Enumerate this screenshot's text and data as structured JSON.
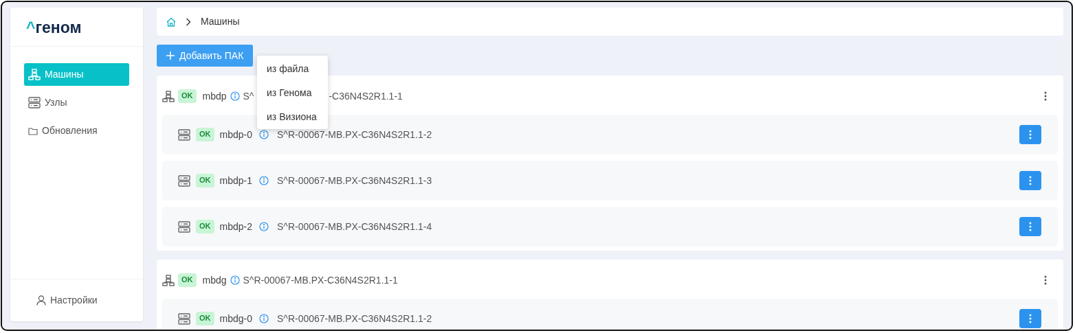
{
  "logo": {
    "mark": "^",
    "text": "геном"
  },
  "sidebar": {
    "items": [
      {
        "label": "Машины",
        "kind": "machines",
        "selected": true
      },
      {
        "label": "Узлы",
        "kind": "server",
        "selected": false
      },
      {
        "label": "Обновления",
        "kind": "folder",
        "selected": false
      }
    ],
    "footer": {
      "label": "Настройки"
    }
  },
  "breadcrumb": {
    "items": [
      "Машины"
    ]
  },
  "add_button": {
    "label": "Добавить ПАК"
  },
  "add_menu": {
    "items": [
      "из файла",
      "из Генома",
      "из Визиона"
    ]
  },
  "machines": [
    {
      "status": "OK",
      "name": "mbdp",
      "code": [
        "S^",
        "-C36N4S2R1.1-1"
      ],
      "nodes": [
        {
          "status": "OK",
          "name": "mbdp-0",
          "code": "S^R-00067-MB.PX-C36N4S2R1.1-2"
        },
        {
          "status": "OK",
          "name": "mbdp-1",
          "code": "S^R-00067-MB.PX-C36N4S2R1.1-3"
        },
        {
          "status": "OK",
          "name": "mbdp-2",
          "code": "S^R-00067-MB.PX-C36N4S2R1.1-4"
        }
      ]
    },
    {
      "status": "OK",
      "name": "mbdg",
      "code": [
        "S^R-00067-MB.PX-C36N4S2R1.1-1"
      ],
      "nodes": [
        {
          "status": "OK",
          "name": "mbdg-0",
          "code": "S^R-00067-MB.PX-C36N4S2R1.1-2"
        }
      ]
    }
  ]
}
